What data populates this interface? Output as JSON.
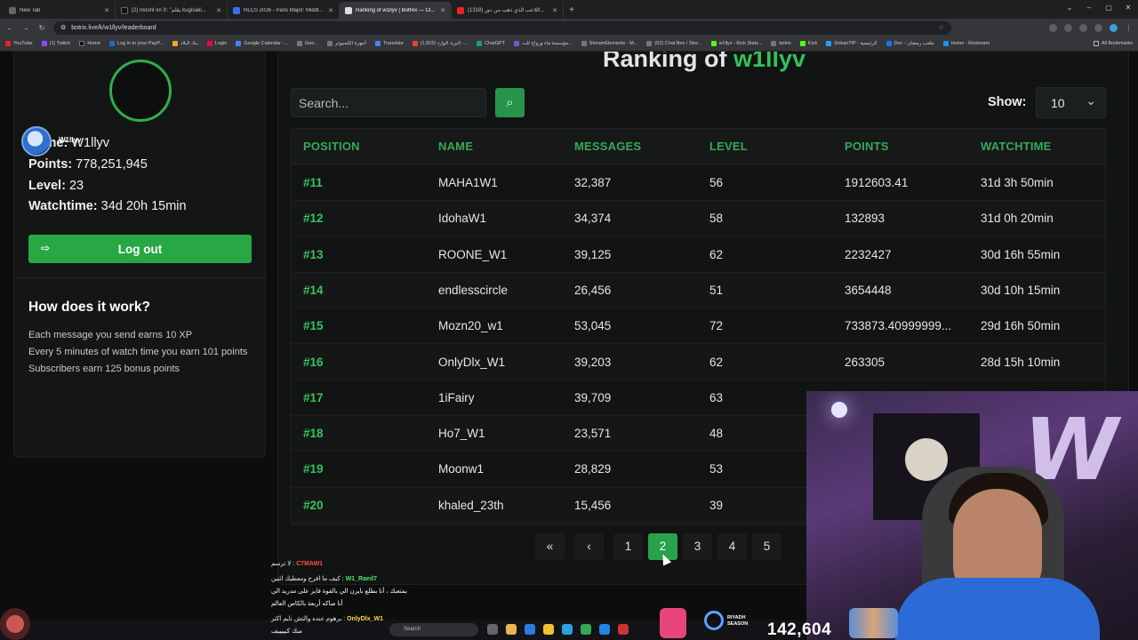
{
  "browser": {
    "tabs": [
      {
        "label": "New Tab",
        "active": false
      },
      {
        "label": "(2) moonl on X: \"يقلم kugisaki...",
        "active": false
      },
      {
        "label": "RLCS 2026 - Paris Major: Middl...",
        "active": false
      },
      {
        "label": "Ranking of w1llyv | BotRix — Cl...",
        "active": true
      },
      {
        "label": "(1318) اللاعب الذي ذهب من دور...",
        "active": false
      }
    ],
    "url": "botrix.live/k/w1llyv/leaderboard",
    "bookmarks": [
      "YouTube",
      "(1) Twitch",
      "Home",
      "Log in to your PayP...",
      "بنك البلاد",
      "Login",
      "Google Calendar -...",
      "Goo...",
      "أجهزة الكمبيوتر",
      "Translate",
      "(1,815) البريد الوارد -...",
      "ChatGPT",
      "مؤسسة ماء ورواج للت...",
      "StreamElements - M...",
      "(52) Chat Box / Stre...",
      "w1llyv - Kick Stats...",
      "botrix",
      "Kick",
      "DokanTIP - الرئيسية",
      "Doc - ملعب رمضان",
      "Home - Restream"
    ],
    "all_bookmarks": "All Bookmarks"
  },
  "sidebar": {
    "name_label": "Name:",
    "name_value": "W1llyv",
    "points_label": "Points:",
    "points_value": "778,251,945",
    "level_label": "Level:",
    "level_value": "23",
    "watchtime_label": "Watchtime:",
    "watchtime_value": "34d 20h 15min",
    "logout_label": "Log out",
    "how_title": "How does it work?",
    "how_lines": [
      "Each message you send earns 10 XP",
      "Every 5 minutes of watch time you earn 101 points",
      "Subscribers earn 125 bonus points"
    ],
    "overlay_name": "W1llyv"
  },
  "main": {
    "title_prefix": "Ranking of ",
    "title_user": "w1llyv",
    "search_placeholder": "Search...",
    "show_label": "Show:",
    "show_value": "10",
    "columns": [
      "POSITION",
      "NAME",
      "MESSAGES",
      "LEVEL",
      "POINTS",
      "WATCHTIME"
    ],
    "rows": [
      {
        "position": "#11",
        "name": "MAHA1W1",
        "messages": "32,387",
        "level": "56",
        "points": "1912603.41",
        "watchtime": "31d 3h 50min"
      },
      {
        "position": "#12",
        "name": "IdohaW1",
        "messages": "34,374",
        "level": "58",
        "points": "132893",
        "watchtime": "31d 0h 20min"
      },
      {
        "position": "#13",
        "name": "ROONE_W1",
        "messages": "39,125",
        "level": "62",
        "points": "2232427",
        "watchtime": "30d 16h 55min"
      },
      {
        "position": "#14",
        "name": "endlesscircle",
        "messages": "26,456",
        "level": "51",
        "points": "3654448",
        "watchtime": "30d 10h 15min"
      },
      {
        "position": "#15",
        "name": "Mozn20_w1",
        "messages": "53,045",
        "level": "72",
        "points": "733873.40999999...",
        "watchtime": "29d 16h 50min"
      },
      {
        "position": "#16",
        "name": "OnlyDlx_W1",
        "messages": "39,203",
        "level": "62",
        "points": "263305",
        "watchtime": "28d 15h 10min"
      },
      {
        "position": "#17",
        "name": "1iFairy",
        "messages": "39,709",
        "level": "63",
        "points": "",
        "watchtime": ""
      },
      {
        "position": "#18",
        "name": "Ho7_W1",
        "messages": "23,571",
        "level": "48",
        "points": "",
        "watchtime": ""
      },
      {
        "position": "#19",
        "name": "Moonw1",
        "messages": "28,829",
        "level": "53",
        "points": "",
        "watchtime": ""
      },
      {
        "position": "#20",
        "name": "khaled_23th",
        "messages": "15,456",
        "level": "39",
        "points": "",
        "watchtime": ""
      }
    ],
    "pagination": {
      "first": "«",
      "prev": "‹",
      "pages": [
        "1",
        "2",
        "3",
        "4",
        "5"
      ],
      "current": "2"
    }
  },
  "overlay": {
    "chat": [
      {
        "user": "C7MAW1",
        "msg": "لا ترسم :"
      },
      {
        "user": "W1_Raed7",
        "msg": "كيف ما افرح ومعطيك اثنين :"
      },
      {
        "user": "",
        "msg": "بمتعبك ، أنا بطلع بايرن الي بالقوة فايز على مدريد الي"
      },
      {
        "user": "",
        "msg": "أنا صاكه أربعة بالكاس العالم"
      },
      {
        "user": "OnlyDlx_W1",
        "msg": "برهوم عنده والتش تايم اكثر :"
      },
      {
        "user": "",
        "msg": "منك كبييييف"
      }
    ],
    "viewer_count": "142,604",
    "sponsor": "RIYADH SEASON",
    "taskbar_search": "Search"
  },
  "colors": {
    "accent": "#2aa14b",
    "accent_text": "#37a857",
    "background": "#0c0e0d"
  }
}
